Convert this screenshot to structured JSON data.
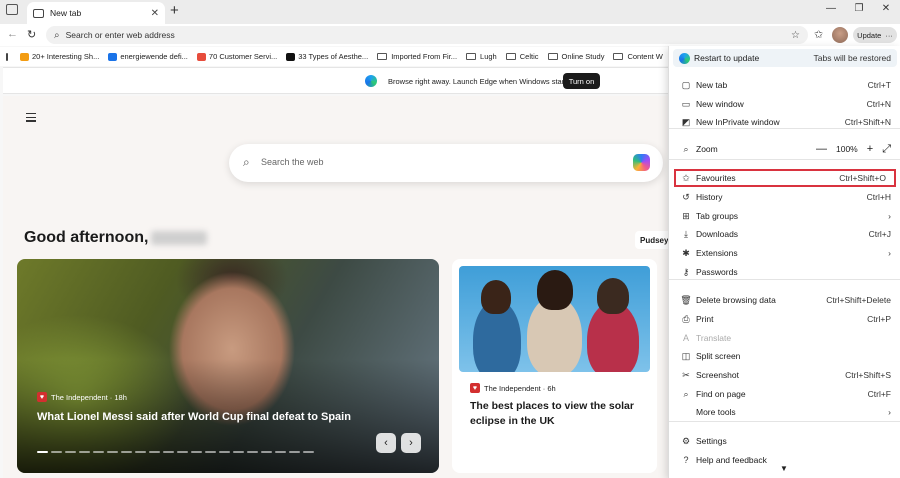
{
  "tab": {
    "title": "New tab",
    "close": "✕",
    "new": "+"
  },
  "window": {
    "minimize": "—",
    "restore": "❐",
    "close": "✕"
  },
  "address": {
    "placeholder": "Search or enter web address",
    "update_label": "Update",
    "more": "···"
  },
  "favourites_bar": [
    {
      "label": "20+ Interesting Sh...",
      "icon": "orange-site-icon",
      "color": "#f39c12"
    },
    {
      "label": "energiewende defi...",
      "icon": "search-icon",
      "color": "#1a73e8"
    },
    {
      "label": "70 Customer Servi...",
      "icon": "red-site-icon",
      "color": "#e74c3c"
    },
    {
      "label": "33 Types of Aesthe...",
      "icon": "z-site-icon",
      "color": "#111111"
    },
    {
      "label": "Imported From Fir...",
      "icon": "folder-icon"
    },
    {
      "label": "Lugh",
      "icon": "folder-icon"
    },
    {
      "label": "Celtic",
      "icon": "folder-icon"
    },
    {
      "label": "Online Study",
      "icon": "folder-icon"
    },
    {
      "label": "Content W",
      "icon": "folder-icon"
    }
  ],
  "banner": {
    "text": "Browse right away. Launch Edge when Windows starts.",
    "button": "Turn on"
  },
  "ntp": {
    "search_placeholder": "Search the web",
    "greeting": "Good afternoon,",
    "pudsey": "Pudsey",
    "main_card": {
      "source": "The Independent · 18h",
      "headline": "What Lionel Messi said after World Cup final defeat to Spain",
      "prev": "‹",
      "next": "›"
    },
    "side_card": {
      "source": "The Independent · 6h",
      "headline": "The best places to view the solar eclipse in the UK"
    }
  },
  "menu": {
    "restart": "Restart to update",
    "restored": "Tabs will be restored",
    "items": [
      {
        "label": "New tab",
        "shortcut": "Ctrl+T",
        "icon": "new-tab-icon"
      },
      {
        "label": "New window",
        "shortcut": "Ctrl+N",
        "icon": "new-window-icon"
      },
      {
        "label": "New InPrivate window",
        "shortcut": "Ctrl+Shift+N",
        "icon": "inprivate-icon"
      },
      {
        "label": "Zoom",
        "shortcut": "",
        "icon": "zoom-icon"
      },
      {
        "label": "Favourites",
        "shortcut": "Ctrl+Shift+O",
        "icon": "favourites-icon"
      },
      {
        "label": "History",
        "shortcut": "Ctrl+H",
        "icon": "history-icon"
      },
      {
        "label": "Tab groups",
        "shortcut": "›",
        "icon": "tab-groups-icon"
      },
      {
        "label": "Downloads",
        "shortcut": "Ctrl+J",
        "icon": "downloads-icon"
      },
      {
        "label": "Extensions",
        "shortcut": "›",
        "icon": "extensions-icon"
      },
      {
        "label": "Passwords",
        "shortcut": "",
        "icon": "passwords-icon"
      },
      {
        "label": "Delete browsing data",
        "shortcut": "Ctrl+Shift+Delete",
        "icon": "delete-icon"
      },
      {
        "label": "Print",
        "shortcut": "Ctrl+P",
        "icon": "print-icon"
      },
      {
        "label": "Translate",
        "shortcut": "",
        "icon": "translate-icon"
      },
      {
        "label": "Split screen",
        "shortcut": "",
        "icon": "split-screen-icon"
      },
      {
        "label": "Screenshot",
        "shortcut": "Ctrl+Shift+S",
        "icon": "screenshot-icon"
      },
      {
        "label": "Find on page",
        "shortcut": "Ctrl+F",
        "icon": "find-icon"
      },
      {
        "label": "More tools",
        "shortcut": "›",
        "icon": ""
      },
      {
        "label": "Settings",
        "shortcut": "",
        "icon": "settings-icon"
      },
      {
        "label": "Help and feedback",
        "shortcut": "",
        "icon": "help-icon"
      }
    ],
    "zoom": {
      "minus": "—",
      "value": "100%",
      "plus": "+",
      "fullscreen": "⤢"
    }
  },
  "colors": {
    "highlight": "#d9333f",
    "accent": "#1a73e8"
  }
}
